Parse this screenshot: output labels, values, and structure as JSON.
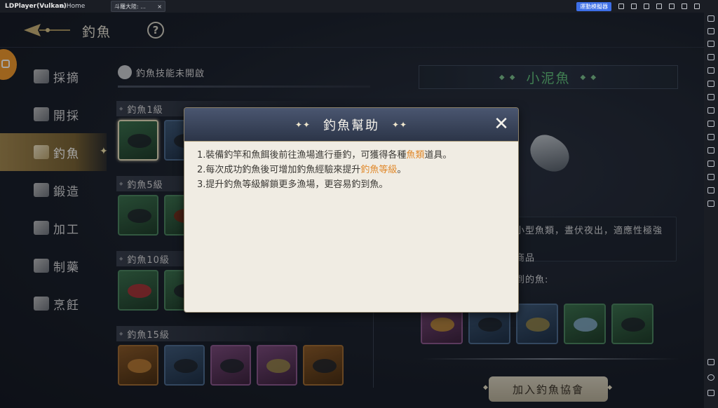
{
  "emulator": {
    "app_name": "LDPlayer(Vulkan)",
    "home_label": "Home",
    "tab_label": "斗羅大陸: ...",
    "badge_label": "運動模擬器"
  },
  "header": {
    "title": "釣魚",
    "help_label": "?"
  },
  "nav": {
    "items": [
      {
        "label": "採摘",
        "icon": "herb-icon"
      },
      {
        "label": "開採",
        "icon": "pickaxe-icon"
      },
      {
        "label": "釣魚",
        "icon": "fishing-icon",
        "active": true
      },
      {
        "label": "鍛造",
        "icon": "anvil-icon"
      },
      {
        "label": "加工",
        "icon": "hammer-icon"
      },
      {
        "label": "制藥",
        "icon": "mortar-icon"
      },
      {
        "label": "烹飪",
        "icon": "cooking-icon"
      }
    ]
  },
  "skill_status": "釣魚技能未開啟",
  "levels": [
    {
      "label": "釣魚1級"
    },
    {
      "label": "釣魚5級"
    },
    {
      "label": "釣魚10級"
    },
    {
      "label": "釣魚15級"
    }
  ],
  "detail": {
    "fish_name": "小泥魚",
    "desc_fragment": "小型魚類，晝伏夜出，適應性極強",
    "use_fragment": "商品",
    "obtain_fragment": "到的魚:",
    "join_button": "加入釣魚協會"
  },
  "dialog": {
    "title": "釣魚幫助",
    "close_icon": "close-icon",
    "lines": {
      "l1_pre": "1.裝備釣竿和魚餌後前往漁場進行垂釣，可獲得各種",
      "l1_hl": "魚類",
      "l1_post": "道具。",
      "l2_pre": "2.每次成功釣魚後可增加釣魚經驗來提升",
      "l2_hl": "釣魚等級",
      "l2_post": "。",
      "l3": "3.提升釣魚等級解鎖更多漁場，更容易釣到魚。"
    }
  },
  "colors": {
    "accent_orange": "#e08a2e",
    "fish_name_green": "#63c27f",
    "nav_active": "#a58a52"
  }
}
